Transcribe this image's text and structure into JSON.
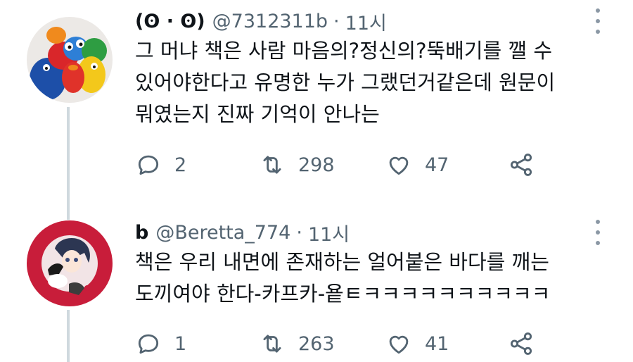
{
  "tweets": [
    {
      "display_name": "(ʘ · ʘ)",
      "handle": "@7312311b",
      "separator": "·",
      "time": "11시",
      "text_lines": [
        "그 머냐 책은 사람 마음의?정신의?뚝배기를 깰 수",
        "있어야한다고 유명한 누가 그랬던거같은데 원문이",
        "뭐였는지 진짜 기억이 안나는"
      ],
      "replies": "2",
      "retweets": "298",
      "likes": "47",
      "avatar_icon": "sesame-street-plush-avatar"
    },
    {
      "display_name": "b",
      "handle": "@Beretta_774",
      "separator": "·",
      "time": "11시",
      "text_lines": [
        "책은 우리 내면에 존재하는 얼어붙은 바다를 깨는",
        "도끼여야 한다-카프카-욭ㅌㅋㅋㅋㅋㅋㅋㅋㅋㅋㅋ"
      ],
      "replies": "1",
      "retweets": "263",
      "likes": "41",
      "avatar_icon": "anime-character-avatar"
    }
  ],
  "colors": {
    "text": "#0f1419",
    "secondary": "#536471",
    "thread_line": "#cfd9de"
  }
}
